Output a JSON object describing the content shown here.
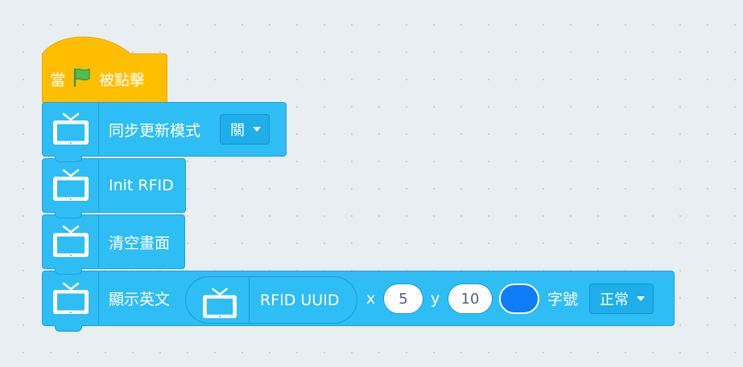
{
  "colors": {
    "hat": "#ffbf00",
    "hat_border": "#e6a800",
    "block": "#2fbdf5",
    "swatch": "#0f7cf7",
    "flag": "#4cbf56"
  },
  "hat_block": {
    "prefix": "當",
    "icon": "green-flag-icon",
    "suffix": "被點擊"
  },
  "blocks": [
    {
      "icon": "tv-icon",
      "label": "同步更新模式",
      "dropdown": "關"
    },
    {
      "icon": "tv-icon",
      "label": "Init RFID"
    },
    {
      "icon": "tv-icon",
      "label": "清空畫面"
    },
    {
      "icon": "tv-icon",
      "label": "顯示英文",
      "reporter": {
        "icon": "tv-icon",
        "label": "RFID UUID"
      },
      "x_label": "x",
      "x_value": "5",
      "y_label": "y",
      "y_value": "10",
      "font_label": "字號",
      "font_value": "正常"
    }
  ]
}
